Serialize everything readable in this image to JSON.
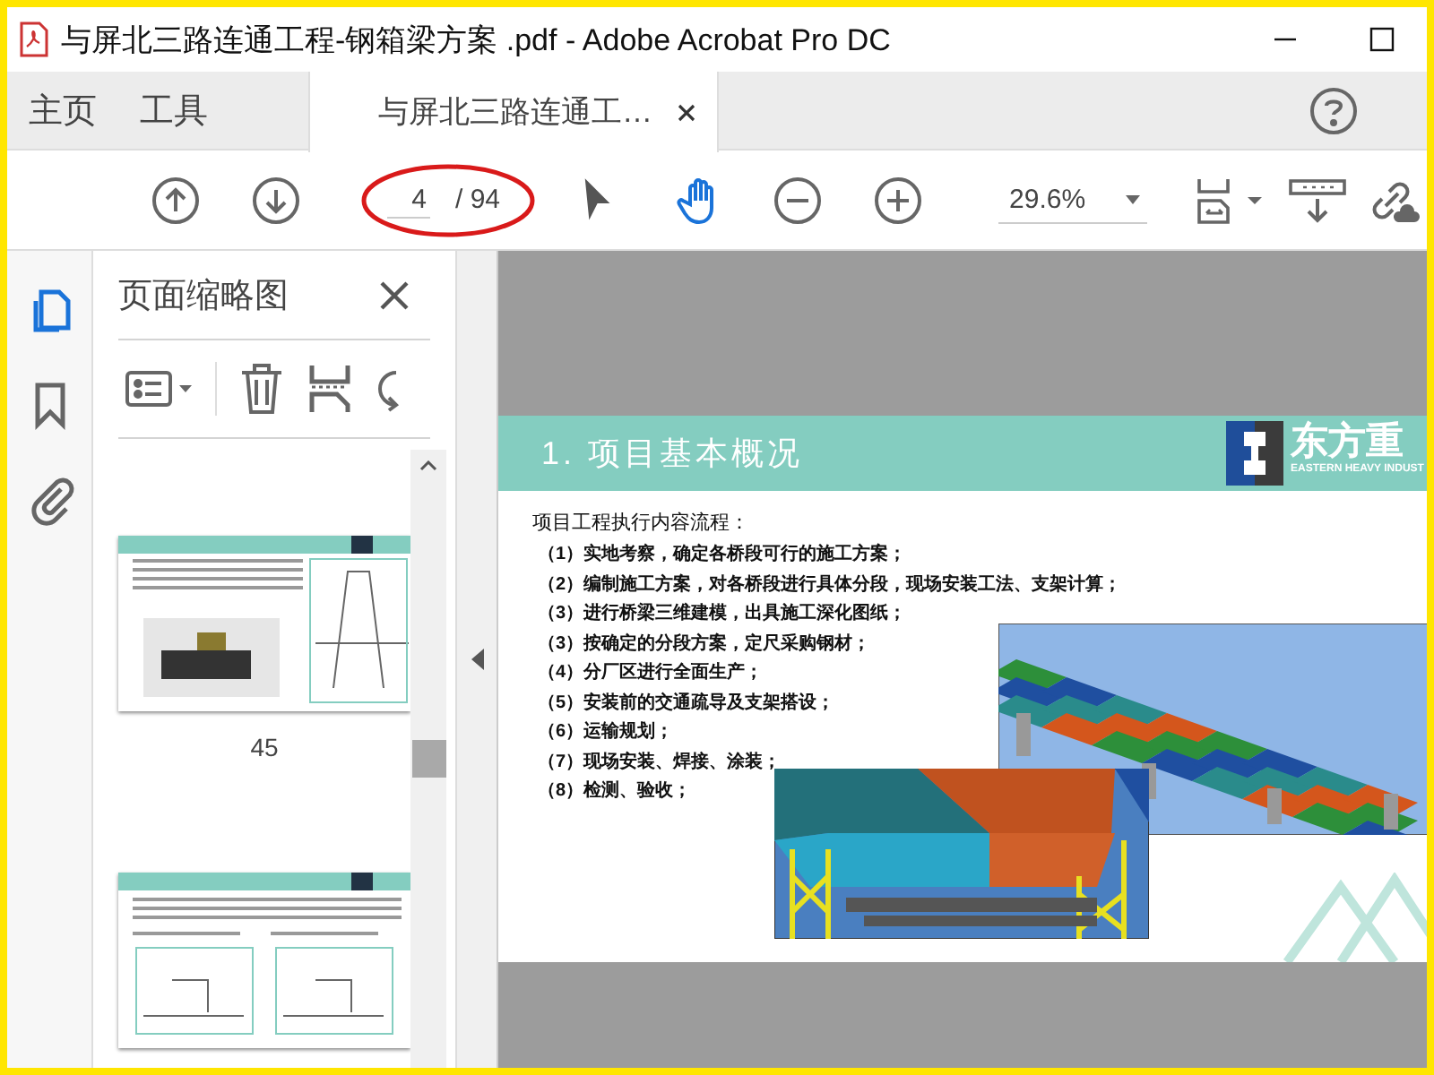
{
  "window": {
    "title": "与屏北三路连通工程-钢箱梁方案 .pdf - Adobe Acrobat Pro DC"
  },
  "tabs": [
    {
      "label": "主页",
      "selected": false
    },
    {
      "label": "工具",
      "selected": false
    },
    {
      "label": "与屏北三路连通工…",
      "selected": true
    }
  ],
  "toolbar": {
    "page_current": "4",
    "page_total": "/ 94",
    "zoom": "29.6%"
  },
  "nav_rail": [
    {
      "kind": "pages",
      "selected": true
    },
    {
      "kind": "bookmarks",
      "selected": false
    },
    {
      "kind": "attachments",
      "selected": false
    }
  ],
  "thumbnail_panel": {
    "title": "页面缩略图",
    "thumbnails": [
      {
        "kind": "machine",
        "label": "45"
      },
      {
        "kind": "section"
      }
    ]
  },
  "document": {
    "heading": "1. 项目基本概况",
    "logo": {
      "name": "东方重",
      "subtitle": "EASTERN HEAVY INDUST"
    },
    "intro": "项目工程执行内容流程：",
    "steps": [
      "（1）实地考察，确定各桥段可行的施工方案；",
      "（2）编制施工方案，对各桥段进行具体分段，现场安装工法、支架计算；",
      "（3）进行桥梁三维建模，出具施工深化图纸；",
      "（3）按确定的分段方案，定尺采购钢材；",
      "（4）分厂区进行全面生产；",
      "（5）安装前的交通疏导及支架搭设；",
      "（6）运输规划；",
      "（7）现场安装、焊接、涂装；",
      "（8）检测、验收；"
    ]
  }
}
